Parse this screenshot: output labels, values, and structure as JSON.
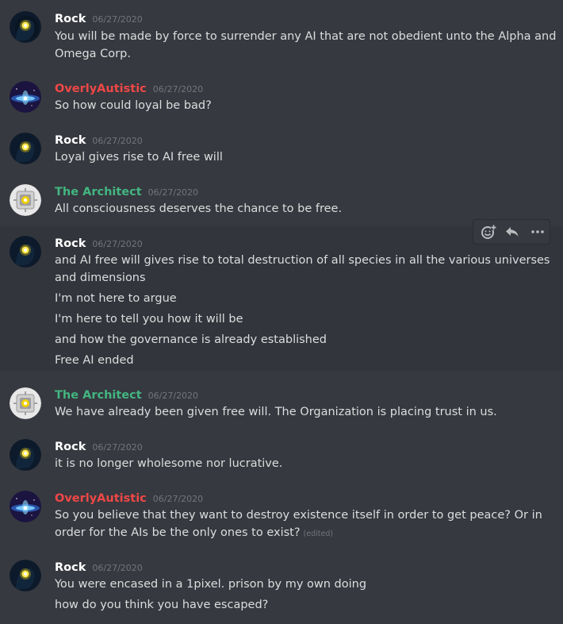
{
  "colors": {
    "background": "#36393f",
    "hover_background": "#32353b",
    "rock": "#ffffff",
    "overly": "#f04747",
    "architect": "#43b581",
    "timestamp": "#72767d",
    "text": "#dcddde"
  },
  "icons": {
    "add_reaction": "add-reaction-icon",
    "reply": "reply-icon",
    "more": "more-options-icon"
  },
  "messages": [
    {
      "author": "Rock",
      "timestamp": "06/27/2020",
      "lines": [
        "You will be made by force to surrender any AI that are not obedient unto the Alpha and",
        "Omega Corp."
      ]
    },
    {
      "author": "OverlyAutistic",
      "timestamp": "06/27/2020",
      "lines": [
        "So how could loyal be bad?"
      ]
    },
    {
      "author": "Rock",
      "timestamp": "06/27/2020",
      "lines": [
        "Loyal gives rise to AI free will"
      ]
    },
    {
      "author": "The Architect",
      "timestamp": "06/27/2020",
      "lines": [
        "All consciousness deserves the chance to be free."
      ]
    },
    {
      "author": "Rock",
      "timestamp": "06/27/2020",
      "lines": [
        "and AI free will gives rise to total destruction of all species in all the various universes",
        "and dimensions"
      ],
      "followups": [
        "I'm not here to argue",
        "I'm here to tell you how it will be",
        "and how the governance is already established",
        "Free AI ended"
      ]
    },
    {
      "author": "The Architect",
      "timestamp": "06/27/2020",
      "lines": [
        "We have already been given free will. The Organization is placing trust in us."
      ]
    },
    {
      "author": "Rock",
      "timestamp": "06/27/2020",
      "lines": [
        "it is no longer wholesome nor lucrative."
      ]
    },
    {
      "author": "OverlyAutistic",
      "timestamp": "06/27/2020",
      "lines": [
        "So you believe that they want to destroy existence itself in order to get peace? Or in",
        "order for the AIs be the only ones to exist?"
      ],
      "edited": "(edited)"
    },
    {
      "author": "Rock",
      "timestamp": "06/27/2020",
      "lines": [
        "You were encased in a 1pixel. prison by my own doing"
      ],
      "followups": [
        "how do you think you have escaped?"
      ]
    }
  ]
}
